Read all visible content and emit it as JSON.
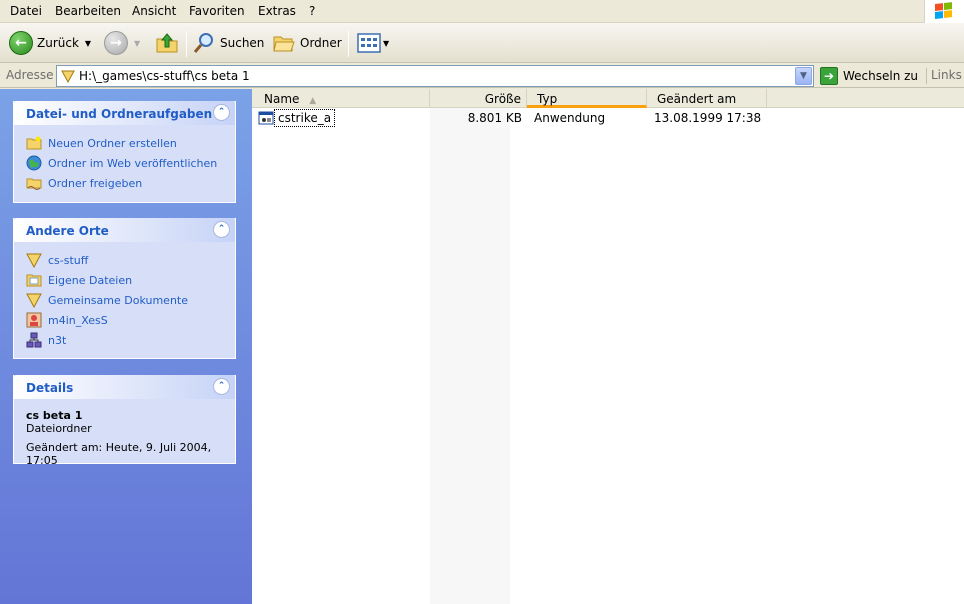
{
  "menubar": {
    "items": [
      "Datei",
      "Bearbeiten",
      "Ansicht",
      "Favoriten",
      "Extras",
      "?"
    ]
  },
  "toolbar": {
    "back_label": "Zurück",
    "search_label": "Suchen",
    "folders_label": "Ordner"
  },
  "address": {
    "label": "Adresse",
    "value": "H:\\_games\\cs-stuff\\cs beta 1",
    "go_label": "Wechseln zu",
    "links_label": "Links"
  },
  "tasks": {
    "title": "Datei- und Ordneraufgaben",
    "items": [
      {
        "label": "Neuen Ordner erstellen",
        "icon": "new-folder-icon"
      },
      {
        "label": "Ordner im Web veröffentlichen",
        "icon": "globe-icon"
      },
      {
        "label": "Ordner freigeben",
        "icon": "share-folder-icon"
      }
    ]
  },
  "places": {
    "title": "Andere Orte",
    "items": [
      {
        "label": "cs-stuff",
        "icon": "network-folder-icon"
      },
      {
        "label": "Eigene Dateien",
        "icon": "documents-icon"
      },
      {
        "label": "Gemeinsame Dokumente",
        "icon": "network-folder-icon"
      },
      {
        "label": "m4in_XesS",
        "icon": "user-icon"
      },
      {
        "label": "n3t",
        "icon": "network-icon"
      }
    ]
  },
  "details": {
    "title": "Details",
    "name": "cs beta 1",
    "type": "Dateiordner",
    "modified": "Geändert am: Heute, 9. Juli 2004, 17:05"
  },
  "columns": {
    "name": "Name",
    "size": "Größe",
    "type": "Typ",
    "modified": "Geändert am"
  },
  "files": [
    {
      "name": "cstrike_a",
      "size": "8.801 KB",
      "type": "Anwendung",
      "modified": "13.08.1999 17:38",
      "icon": "application-icon"
    }
  ],
  "colors": {
    "taskpane_top": "#7ba2e7",
    "taskpane_bottom": "#6375d6",
    "link_blue": "#215dc6",
    "sort_accent": "#f9a20e"
  }
}
